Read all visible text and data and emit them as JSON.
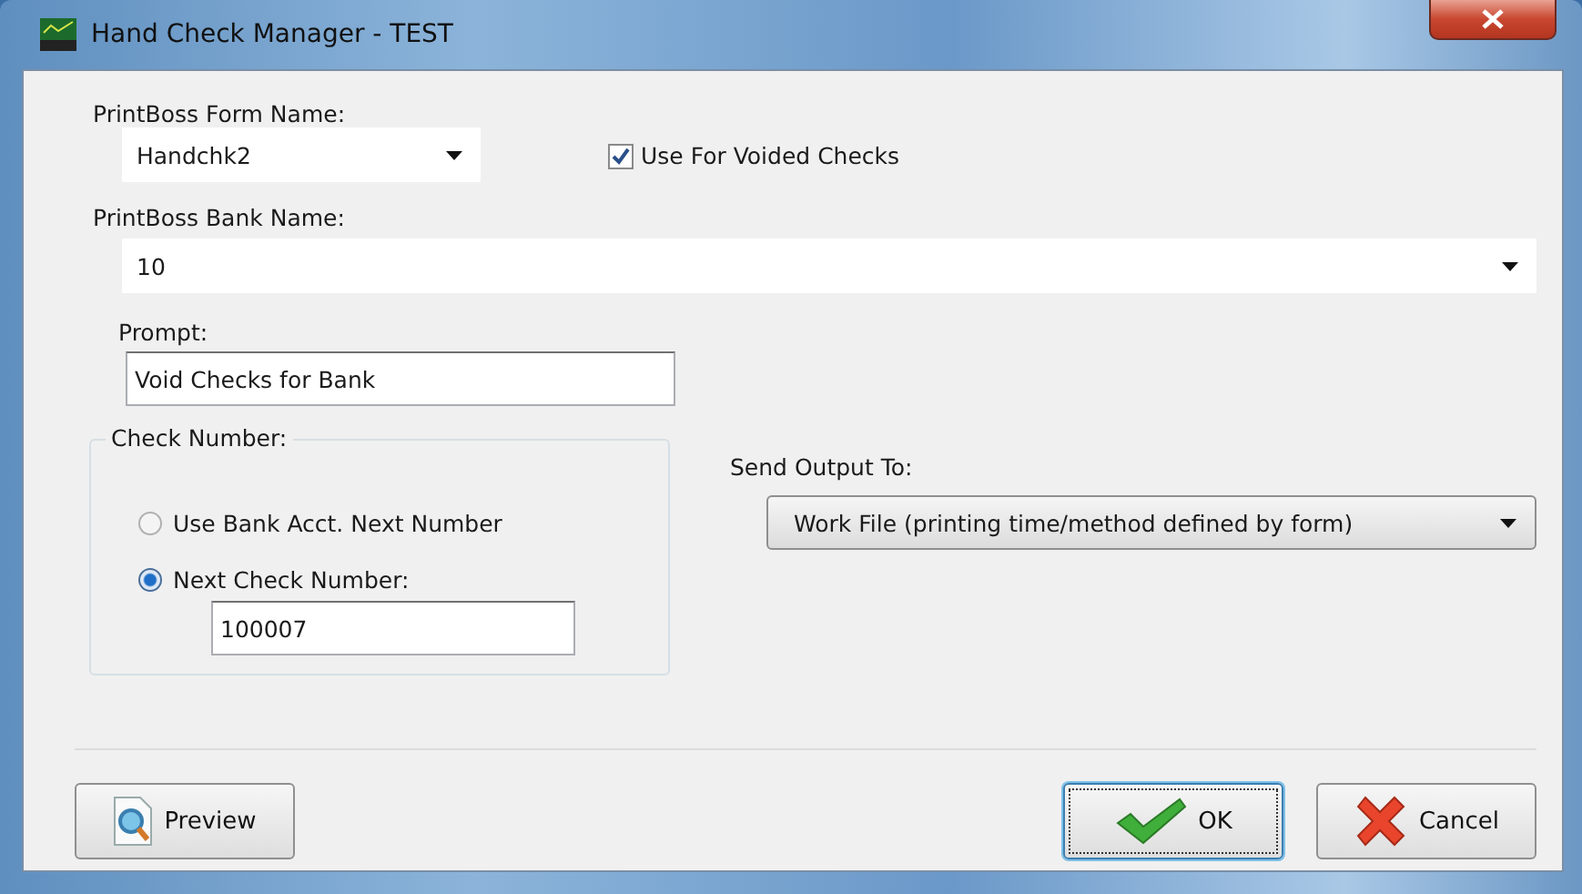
{
  "window": {
    "title": "Hand Check Manager - TEST"
  },
  "form_name": {
    "label": "PrintBoss Form Name:",
    "value": "Handchk2"
  },
  "voided_checks": {
    "label": "Use For Voided Checks",
    "checked": true
  },
  "bank_name": {
    "label": "PrintBoss Bank Name:",
    "value": "10"
  },
  "prompt": {
    "label": "Prompt:",
    "value": "Void Checks for Bank"
  },
  "check_number": {
    "title": "Check Number:",
    "options": [
      {
        "label": "Use Bank Acct. Next Number",
        "selected": false
      },
      {
        "label": "Next Check Number:",
        "selected": true
      }
    ],
    "value": "100007"
  },
  "send_output": {
    "label": "Send Output To:",
    "value": "Work File (printing time/method defined by form)"
  },
  "buttons": [
    {
      "kind": "preview",
      "label": "Preview",
      "focused": false
    },
    {
      "kind": "ok",
      "label": "OK",
      "focused": true
    },
    {
      "kind": "cancel",
      "label": "Cancel",
      "focused": false
    }
  ]
}
